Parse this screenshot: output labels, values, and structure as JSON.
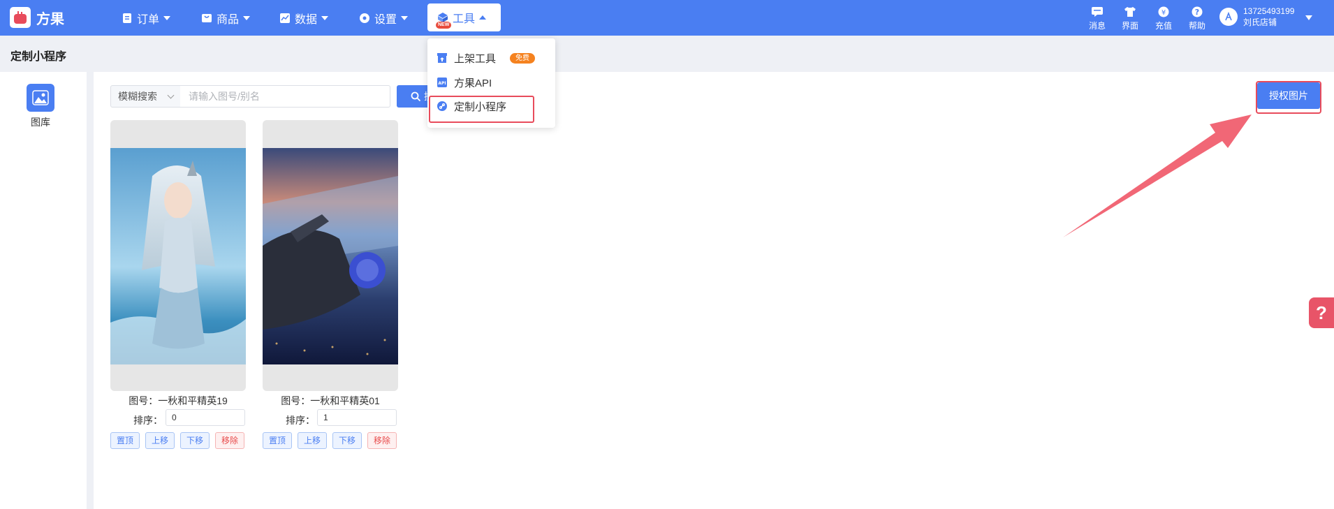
{
  "brand": {
    "name": "方果"
  },
  "nav": {
    "orders": "订单",
    "products": "商品",
    "data": "数据",
    "settings": "设置",
    "tools": "工具",
    "tools_badge": "NEW"
  },
  "topright": {
    "messages": "消息",
    "interface": "界面",
    "recharge": "充值",
    "help": "帮助",
    "user_phone": "13725493199",
    "user_shop": "刘氏店铺"
  },
  "page": {
    "title": "定制小程序"
  },
  "sidebar": {
    "gallery_label": "图库"
  },
  "search": {
    "mode": "模糊搜索",
    "placeholder": "请输入图号/别名",
    "button_label": "搜索"
  },
  "auth_button": "授权图片",
  "tools_menu": {
    "items": [
      {
        "label": "上架工具",
        "badge": "免费"
      },
      {
        "label": "方果API"
      },
      {
        "label": "定制小程序"
      }
    ]
  },
  "cards": [
    {
      "name": "图号：一秋和平精英19",
      "sort_label": "排序：",
      "sort_value": "0",
      "actions": [
        "置顶",
        "上移",
        "下移",
        "移除"
      ]
    },
    {
      "name": "图号：一秋和平精英01",
      "sort_label": "排序：",
      "sort_value": "1",
      "actions": [
        "置顶",
        "上移",
        "下移",
        "移除"
      ]
    }
  ],
  "help_float": "?",
  "colors": {
    "primary": "#4a7ef2",
    "highlight": "#e84b5b",
    "free": "#f5821f"
  }
}
